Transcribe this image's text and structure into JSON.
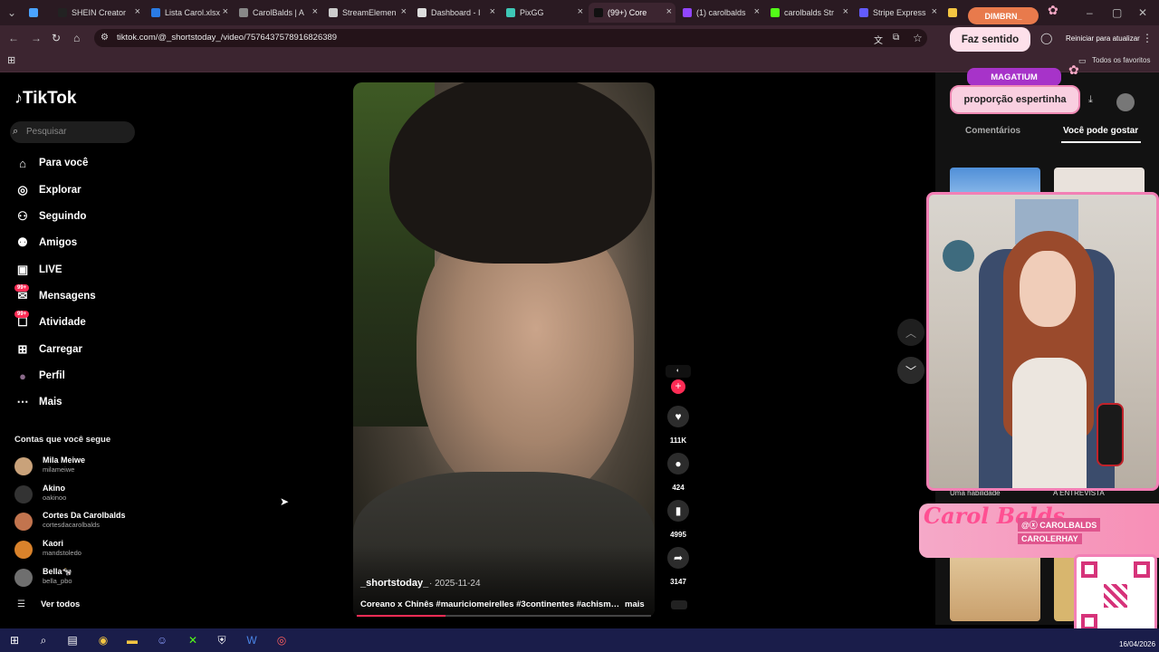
{
  "browser": {
    "tabs": [
      {
        "label": "",
        "color": "#4aa3ff"
      },
      {
        "label": "SHEIN Creator",
        "color": "#222222"
      },
      {
        "label": "Lista Carol.xlsx",
        "color": "#2a7be4"
      },
      {
        "label": "CarolBalds | A",
        "color": "#888888"
      },
      {
        "label": "StreamElemen",
        "color": "#cccccc"
      },
      {
        "label": "Dashboard - I",
        "color": "#dddddd"
      },
      {
        "label": "PixGG",
        "color": "#3ec7b6"
      },
      {
        "label": "(99+) Core",
        "color": "#111111"
      },
      {
        "label": "(1) carolbalds",
        "color": "#9146ff"
      },
      {
        "label": "carolbalds Str",
        "color": "#53fc18"
      },
      {
        "label": "Stripe Express",
        "color": "#635bff"
      },
      {
        "label": "ca",
        "color": "#f4c542"
      }
    ],
    "url": "tiktok.com/@_shortstoday_/video/7576437578916826389",
    "restart_label": "Reiniciar para atualizar",
    "bookmarks_label": "Todos os favoritos"
  },
  "tiktok": {
    "logo": "TikTok",
    "search_placeholder": "Pesquisar",
    "nav": [
      {
        "label": "Para você",
        "icon": "home-icon"
      },
      {
        "label": "Explorar",
        "icon": "compass-icon"
      },
      {
        "label": "Seguindo",
        "icon": "following-icon"
      },
      {
        "label": "Amigos",
        "icon": "friends-icon"
      },
      {
        "label": "LIVE",
        "icon": "live-icon"
      },
      {
        "label": "Mensagens",
        "icon": "messages-icon",
        "badge": "99+"
      },
      {
        "label": "Atividade",
        "icon": "activity-icon",
        "badge": "99+"
      },
      {
        "label": "Carregar",
        "icon": "upload-icon"
      },
      {
        "label": "Perfil",
        "icon": "avatar"
      },
      {
        "label": "Mais",
        "icon": "more-icon"
      }
    ],
    "following_title": "Contas que você segue",
    "accounts": [
      {
        "name": "Mila Meiwe",
        "handle": "milameiwe",
        "color": "#c9a27a"
      },
      {
        "name": "Akino",
        "handle": "oakinoo",
        "color": "#333333"
      },
      {
        "name": "Cortes Da Carolbalds",
        "handle": "cortesdacarolbalds",
        "color": "#c2744e"
      },
      {
        "name": "Kaori",
        "handle": "mandstoledo",
        "color": "#d9822b"
      },
      {
        "name": "Bella🐄",
        "handle": "bella_pbo",
        "color": "#6f6f6f"
      }
    ],
    "see_all": "Ver todos",
    "video": {
      "author": "_shortstoday_",
      "date": "· 2025-11-24",
      "caption": "Coreano x Chinês #mauriciomeirelles #3continentes #achismo...",
      "more": "mais",
      "progress": 0.3
    },
    "actions": {
      "likes": "111K",
      "comments": "424",
      "saves": "4995",
      "shares": "3147"
    },
    "right_panel": {
      "tab_comments": "Comentários",
      "tab_recommend": "Você pode gostar",
      "sub_left": "Uma habilidade",
      "sub_right": "A ENTREVISTA"
    }
  },
  "overlays": {
    "dim": "DIMBRN_",
    "faz_sentido": "Faz sentido",
    "magatium": "MAGATIUM",
    "proporcao": "proporção espertinha",
    "brand_logo": "Carol Balds",
    "instagram": "@ⓧ CAROLBALDS",
    "youtube": "CAROLERHAY"
  },
  "taskbar": {
    "date": "16/04/2026"
  },
  "colors": {
    "accent": "#fe2c55",
    "pink": "#f27fb5"
  }
}
